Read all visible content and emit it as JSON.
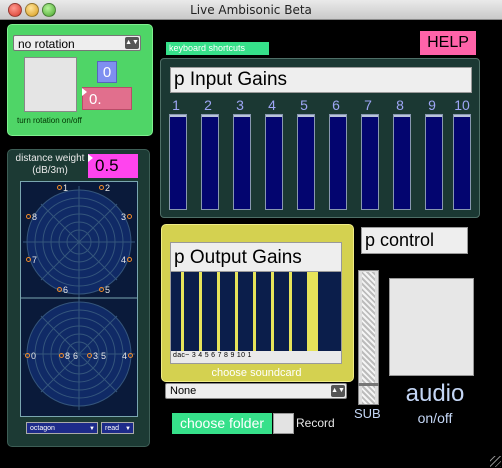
{
  "window": {
    "title": "Live Ambisonic Beta"
  },
  "rotation": {
    "dropdown_value": "no rotation",
    "small_number": "0",
    "wide_number": "0.",
    "toggle_label": "turn rotation on/off"
  },
  "distance": {
    "label_line1": "distance weight",
    "label_line2": "(dB/3m)",
    "value": "0.5"
  },
  "speaker_layout": {
    "top_grid_numbers": [
      "1",
      "2",
      "3",
      "4",
      "5",
      "6",
      "7",
      "8"
    ],
    "bottom_grid_numbers": [
      "0",
      "8",
      "6",
      "3",
      "5",
      "4"
    ],
    "preset_value": "octagon",
    "file_value": "read"
  },
  "header": {
    "shortcuts_label": "keyboard shortcuts",
    "help_label": "HELP"
  },
  "input_gains": {
    "title": "p Input Gains",
    "channels": [
      "1",
      "2",
      "3",
      "4",
      "5",
      "6",
      "7",
      "8",
      "9",
      "10"
    ]
  },
  "output_gains": {
    "title": "p Output Gains",
    "dac_label": "dac~ 3 4 5 6 7 8 9 10 1",
    "choose_soundcard_label": "choose soundcard",
    "soundcard_value": "None"
  },
  "control": {
    "pcontrol_label": "p control",
    "sub_label": "SUB",
    "audio_label": "audio",
    "onoff_label": "on/off"
  },
  "recording": {
    "choose_folder_label": "choose folder",
    "record_label": "Record"
  }
}
